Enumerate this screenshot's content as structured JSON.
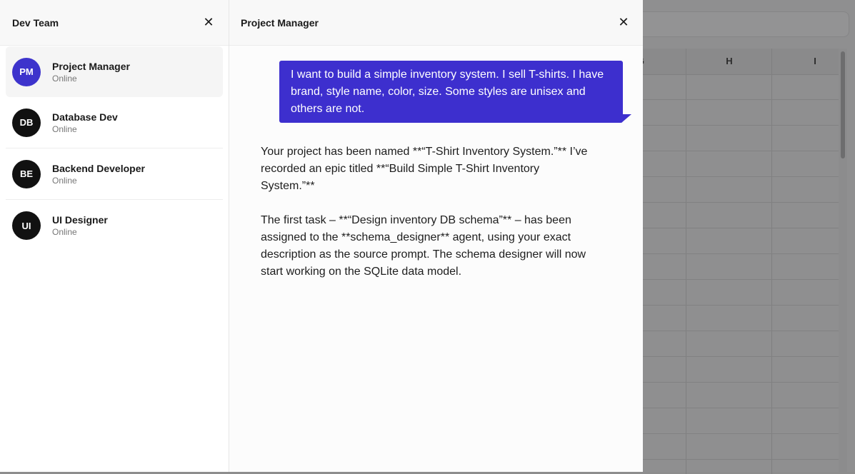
{
  "sidebar": {
    "title": "Dev Team",
    "close_label": "✕",
    "members": [
      {
        "initials": "PM",
        "name": "Project Manager",
        "status": "Online"
      },
      {
        "initials": "DB",
        "name": "Database Dev",
        "status": "Online"
      },
      {
        "initials": "BE",
        "name": "Backend Developer",
        "status": "Online"
      },
      {
        "initials": "UI",
        "name": "UI Designer",
        "status": "Online"
      }
    ]
  },
  "chat": {
    "title": "Project Manager",
    "close_label": "✕",
    "user_message": "I want to build a simple inventory system. I sell T-shirts. I have brand, style name, color, size. Some styles are unisex and others are not.",
    "assistant_paragraphs": [
      "Your project has been named **“T-Shirt Inventory System.”** I’ve recorded an epic titled **“Build Simple T-Shirt Inventory System.”**",
      "The first task – **“Design inventory DB schema”** – has been assigned to the **schema_designer** agent, using your exact description as the source prompt. The schema designer will now start working on the SQLite data model."
    ]
  },
  "spreadsheet": {
    "columns": [
      "G",
      "H",
      "I"
    ]
  },
  "colors": {
    "accent": "#3d2fce",
    "avatar_default": "#111111"
  }
}
